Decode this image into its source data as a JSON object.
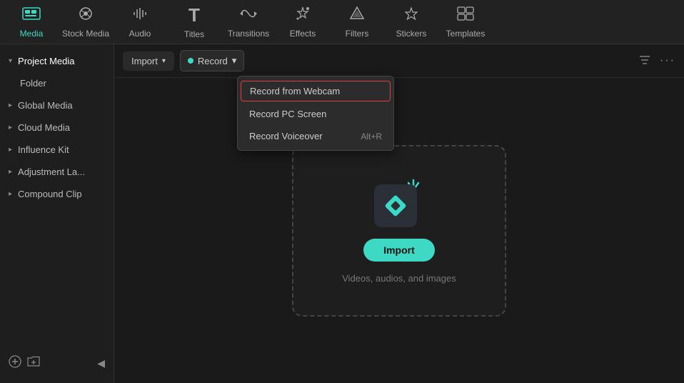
{
  "topNav": {
    "items": [
      {
        "id": "media",
        "label": "Media",
        "icon": "🎞",
        "active": true
      },
      {
        "id": "stock-media",
        "label": "Stock Media",
        "icon": "📷",
        "active": false
      },
      {
        "id": "audio",
        "label": "Audio",
        "icon": "🎵",
        "active": false
      },
      {
        "id": "titles",
        "label": "Titles",
        "icon": "T",
        "active": false
      },
      {
        "id": "transitions",
        "label": "Transitions",
        "icon": "↔",
        "active": false
      },
      {
        "id": "effects",
        "label": "Effects",
        "icon": "✨",
        "active": false
      },
      {
        "id": "filters",
        "label": "Filters",
        "icon": "🔷",
        "active": false
      },
      {
        "id": "stickers",
        "label": "Stickers",
        "icon": "💎",
        "active": false
      },
      {
        "id": "templates",
        "label": "Templates",
        "icon": "⊞",
        "active": false
      }
    ]
  },
  "sidebar": {
    "items": [
      {
        "id": "project-media",
        "label": "Project Media",
        "active": true,
        "chevron": "▾",
        "indent": false
      },
      {
        "id": "folder",
        "label": "Folder",
        "active": false,
        "indent": true
      },
      {
        "id": "global-media",
        "label": "Global Media",
        "active": false,
        "chevron": "▸",
        "indent": false
      },
      {
        "id": "cloud-media",
        "label": "Cloud Media",
        "active": false,
        "chevron": "▸",
        "indent": false
      },
      {
        "id": "influence-kit",
        "label": "Influence Kit",
        "active": false,
        "chevron": "▸",
        "indent": false
      },
      {
        "id": "adjustment-la",
        "label": "Adjustment La...",
        "active": false,
        "chevron": "▸",
        "indent": false
      },
      {
        "id": "compound-clip",
        "label": "Compound Clip",
        "active": false,
        "chevron": "▸",
        "indent": false
      }
    ],
    "footer": {
      "new_icon": "+",
      "folder_icon": "📁",
      "collapse_icon": "◀"
    }
  },
  "toolbar": {
    "import_label": "Import",
    "record_label": "Record",
    "filter_icon": "⚙",
    "more_icon": "•••"
  },
  "dropdown": {
    "items": [
      {
        "id": "record-webcam",
        "label": "Record from Webcam",
        "shortcut": "",
        "highlighted": true
      },
      {
        "id": "record-pc",
        "label": "Record PC Screen",
        "shortcut": ""
      },
      {
        "id": "record-voiceover",
        "label": "Record Voiceover",
        "shortcut": "Alt+R"
      }
    ]
  },
  "importArea": {
    "button_label": "Import",
    "subtext": "Videos, audios, and images"
  }
}
